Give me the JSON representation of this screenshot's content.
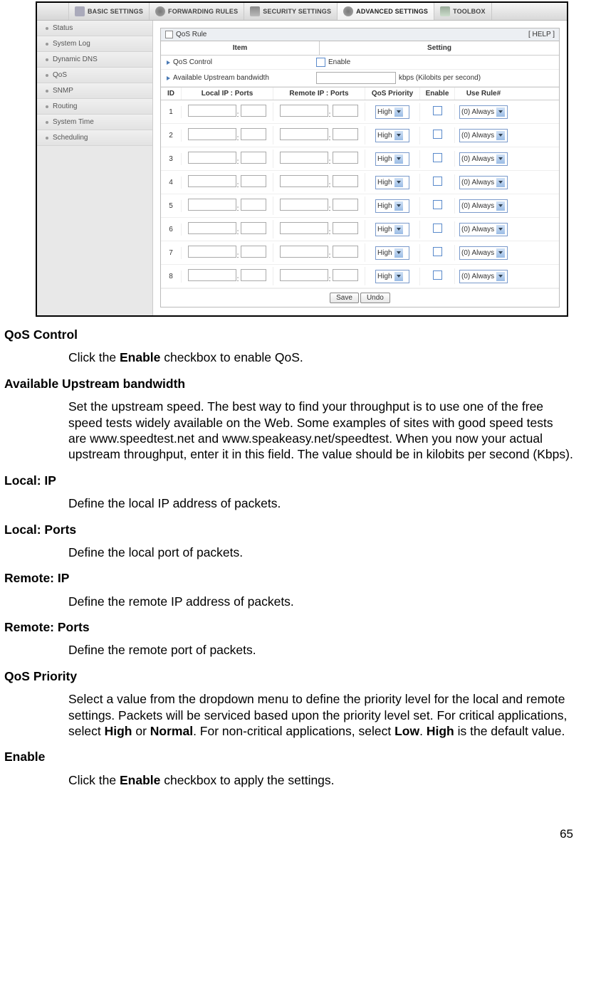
{
  "topnav": {
    "tabs": [
      {
        "label": "BASIC SETTINGS"
      },
      {
        "label": "FORWARDING RULES"
      },
      {
        "label": "SECURITY SETTINGS"
      },
      {
        "label": "ADVANCED SETTINGS"
      },
      {
        "label": "TOOLBOX"
      }
    ]
  },
  "sidebar": {
    "items": [
      {
        "label": "Status"
      },
      {
        "label": "System Log"
      },
      {
        "label": "Dynamic DNS"
      },
      {
        "label": "QoS"
      },
      {
        "label": "SNMP"
      },
      {
        "label": "Routing"
      },
      {
        "label": "System Time"
      },
      {
        "label": "Scheduling"
      }
    ]
  },
  "panel": {
    "title": "QoS Rule",
    "help": "[ HELP ]",
    "header_item": "Item",
    "header_setting": "Setting",
    "qos_control_label": "QoS Control",
    "enable_label": "Enable",
    "bw_label": "Available Upstream bandwidth",
    "bw_unit": "kbps (Kilobits per second)",
    "cols": {
      "id": "ID",
      "local": "Local IP : Ports",
      "remote": "Remote IP : Ports",
      "priority": "QoS Priority",
      "enable": "Enable",
      "use": "Use Rule#"
    },
    "row_ids": [
      "1",
      "2",
      "3",
      "4",
      "5",
      "6",
      "7",
      "8"
    ],
    "priority_value": "High",
    "use_rule_value": "(0) Always",
    "save": "Save",
    "undo": "Undo"
  },
  "doc": {
    "s1": {
      "h": "QoS Control",
      "p_pre": "Click the ",
      "p_b": "Enable",
      "p_post": " checkbox to enable QoS."
    },
    "s2": {
      "h": "Available Upstream bandwidth",
      "p": "Set the upstream speed. The best way to find your throughput is to use one of the free speed tests widely available on the Web. Some examples of sites with good speed tests are www.speedtest.net and www.speakeasy.net/speedtest. When you now your actual upstream throughput, enter it in this field. The value should be in kilobits per second (Kbps)."
    },
    "s3": {
      "h": "Local: IP",
      "p": "Define the local IP address of packets."
    },
    "s4": {
      "h": "Local: Ports",
      "p": "Define the local port of packets."
    },
    "s5": {
      "h": "Remote: IP",
      "p": "Define the remote IP address of packets."
    },
    "s6": {
      "h": "Remote: Ports",
      "p": "Define the remote port of packets."
    },
    "s7": {
      "h": "QoS Priority",
      "p_a": "Select a value from the dropdown menu to define the priority level for the local and remote settings. Packets will be serviced based upon the priority level set. For critical applications, select ",
      "b1": "High",
      "p_b": " or ",
      "b2": "Normal",
      "p_c": ". For non-critical applications, select ",
      "b3": "Low",
      "p_d": ". ",
      "b4": "High",
      "p_e": " is the default value."
    },
    "s8": {
      "h": "Enable",
      "p_pre": "Click the ",
      "p_b": "Enable",
      "p_post": " checkbox to apply the settings."
    }
  },
  "page_number": "65"
}
